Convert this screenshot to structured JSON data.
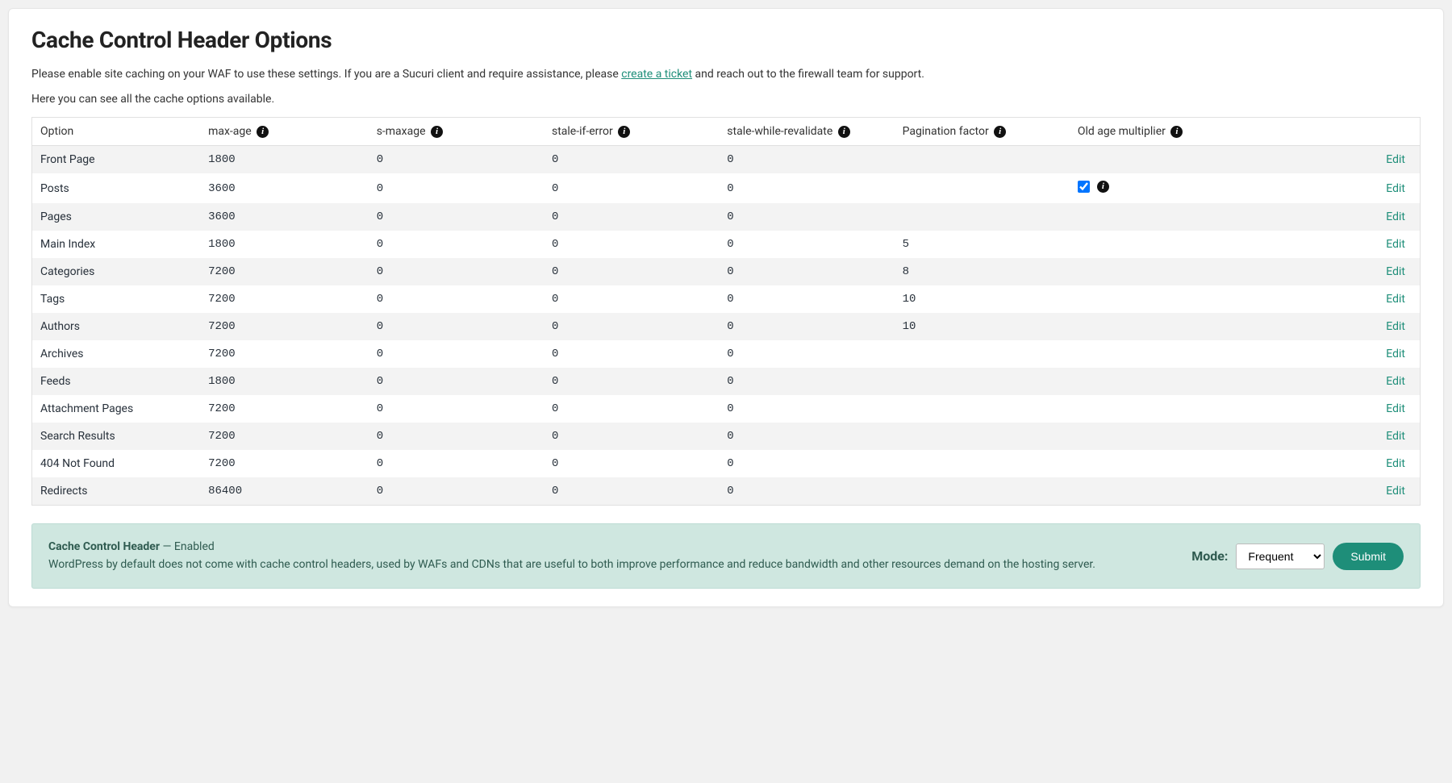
{
  "title": "Cache Control Header Options",
  "intro_pre": "Please enable site caching on your WAF to use these settings. If you are a Sucuri client and require assistance, please ",
  "intro_link": "create a ticket",
  "intro_post": " and reach out to the firewall team for support.",
  "sub": "Here you can see all the cache options available.",
  "columns": {
    "option": "Option",
    "max_age": "max-age",
    "s_maxage": "s-maxage",
    "stale_if_error": "stale-if-error",
    "stale_while_revalidate": "stale-while-revalidate",
    "pagination_factor": "Pagination factor",
    "old_age_multiplier": "Old age multiplier"
  },
  "edit_label": "Edit",
  "rows": [
    {
      "option": "Front Page",
      "max_age": "1800",
      "s_maxage": "0",
      "stale_if_error": "0",
      "stale_while_revalidate": "0",
      "pagination": "",
      "old_age_checkbox": false
    },
    {
      "option": "Posts",
      "max_age": "3600",
      "s_maxage": "0",
      "stale_if_error": "0",
      "stale_while_revalidate": "0",
      "pagination": "",
      "old_age_checkbox": true,
      "old_age_checked": true
    },
    {
      "option": "Pages",
      "max_age": "3600",
      "s_maxage": "0",
      "stale_if_error": "0",
      "stale_while_revalidate": "0",
      "pagination": "",
      "old_age_checkbox": false
    },
    {
      "option": "Main Index",
      "max_age": "1800",
      "s_maxage": "0",
      "stale_if_error": "0",
      "stale_while_revalidate": "0",
      "pagination": "5",
      "old_age_checkbox": false
    },
    {
      "option": "Categories",
      "max_age": "7200",
      "s_maxage": "0",
      "stale_if_error": "0",
      "stale_while_revalidate": "0",
      "pagination": "8",
      "old_age_checkbox": false
    },
    {
      "option": "Tags",
      "max_age": "7200",
      "s_maxage": "0",
      "stale_if_error": "0",
      "stale_while_revalidate": "0",
      "pagination": "10",
      "old_age_checkbox": false
    },
    {
      "option": "Authors",
      "max_age": "7200",
      "s_maxage": "0",
      "stale_if_error": "0",
      "stale_while_revalidate": "0",
      "pagination": "10",
      "old_age_checkbox": false
    },
    {
      "option": "Archives",
      "max_age": "7200",
      "s_maxage": "0",
      "stale_if_error": "0",
      "stale_while_revalidate": "0",
      "pagination": "",
      "old_age_checkbox": false
    },
    {
      "option": "Feeds",
      "max_age": "1800",
      "s_maxage": "0",
      "stale_if_error": "0",
      "stale_while_revalidate": "0",
      "pagination": "",
      "old_age_checkbox": false
    },
    {
      "option": "Attachment Pages",
      "max_age": "7200",
      "s_maxage": "0",
      "stale_if_error": "0",
      "stale_while_revalidate": "0",
      "pagination": "",
      "old_age_checkbox": false
    },
    {
      "option": "Search Results",
      "max_age": "7200",
      "s_maxage": "0",
      "stale_if_error": "0",
      "stale_while_revalidate": "0",
      "pagination": "",
      "old_age_checkbox": false
    },
    {
      "option": "404 Not Found",
      "max_age": "7200",
      "s_maxage": "0",
      "stale_if_error": "0",
      "stale_while_revalidate": "0",
      "pagination": "",
      "old_age_checkbox": false
    },
    {
      "option": "Redirects",
      "max_age": "86400",
      "s_maxage": "0",
      "stale_if_error": "0",
      "stale_while_revalidate": "0",
      "pagination": "",
      "old_age_checkbox": false
    }
  ],
  "status": {
    "label": "Cache Control Header",
    "separator": " — ",
    "state": "Enabled",
    "description": "WordPress by default does not come with cache control headers, used by WAFs and CDNs that are useful to both improve performance and reduce bandwidth and other resources demand on the hosting server.",
    "mode_label": "Mode:",
    "mode_selected": "Frequent",
    "submit": "Submit"
  }
}
